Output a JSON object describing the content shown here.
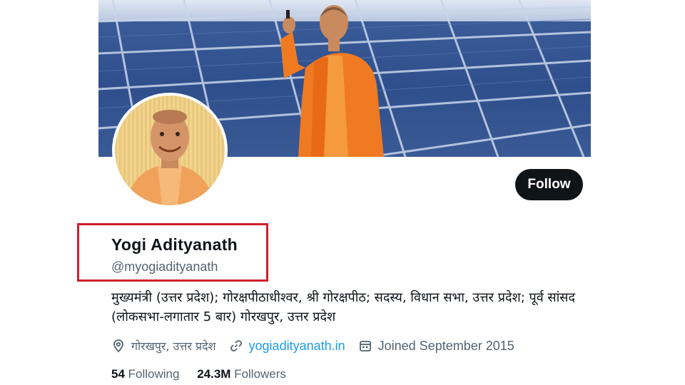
{
  "profile": {
    "display_name": "Yogi Adityanath",
    "handle": "@myogiadityanath",
    "bio": "मुख्यमंत्री (उत्तर प्रदेश); गोरक्षपीठाधीश्वर, श्री गोरक्षपीठ; सदस्य, विधान सभा, उत्तर प्रदेश; पूर्व सांसद (लोकसभा-लगातार 5 बार) गोरखपुर, उत्तर प्रदेश",
    "location": "गोरखपुर, उत्तर प्रदेश",
    "website": "yogiadityanath.in",
    "joined": "Joined September 2015",
    "following_count": "54",
    "following_label": "Following",
    "followers_count": "24.3M",
    "followers_label": "Followers"
  },
  "actions": {
    "follow_label": "Follow"
  },
  "icons": {
    "location": "location-pin-icon",
    "website": "link-icon",
    "joined": "calendar-icon"
  },
  "colors": {
    "accent_link": "#1d9bf0",
    "follow_button": "#0f1419",
    "highlight_box": "#d11f2b"
  }
}
